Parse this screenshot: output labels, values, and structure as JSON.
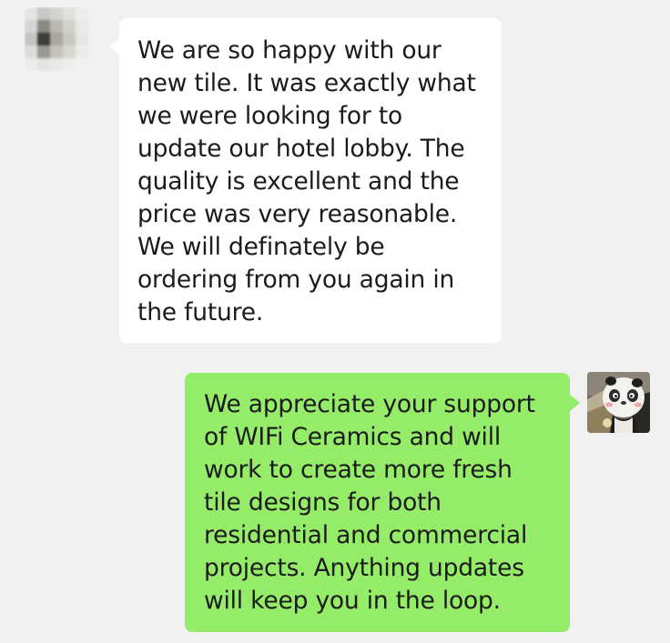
{
  "conversation": {
    "messages": [
      {
        "sender": "contact",
        "text": "We are so happy with our\nnew tile. It was exactly what\nwe were looking for to\nupdate our hotel lobby. The\nquality is excellent and the\nprice was very reasonable.\nWe will definately be\nordering from you again in\nthe future."
      },
      {
        "sender": "self",
        "text": "We appreciate your support\nof WIFi Ceramics and will\nwork to create more fresh\ntile designs for both\nresidential and commercial\nprojects. Anything updates\nwill keep you in the loop."
      }
    ]
  },
  "colors": {
    "background": "#f1f1f1",
    "incoming_bubble": "#ffffff",
    "outgoing_bubble": "#95ec69",
    "text": "#1b1b1b"
  }
}
